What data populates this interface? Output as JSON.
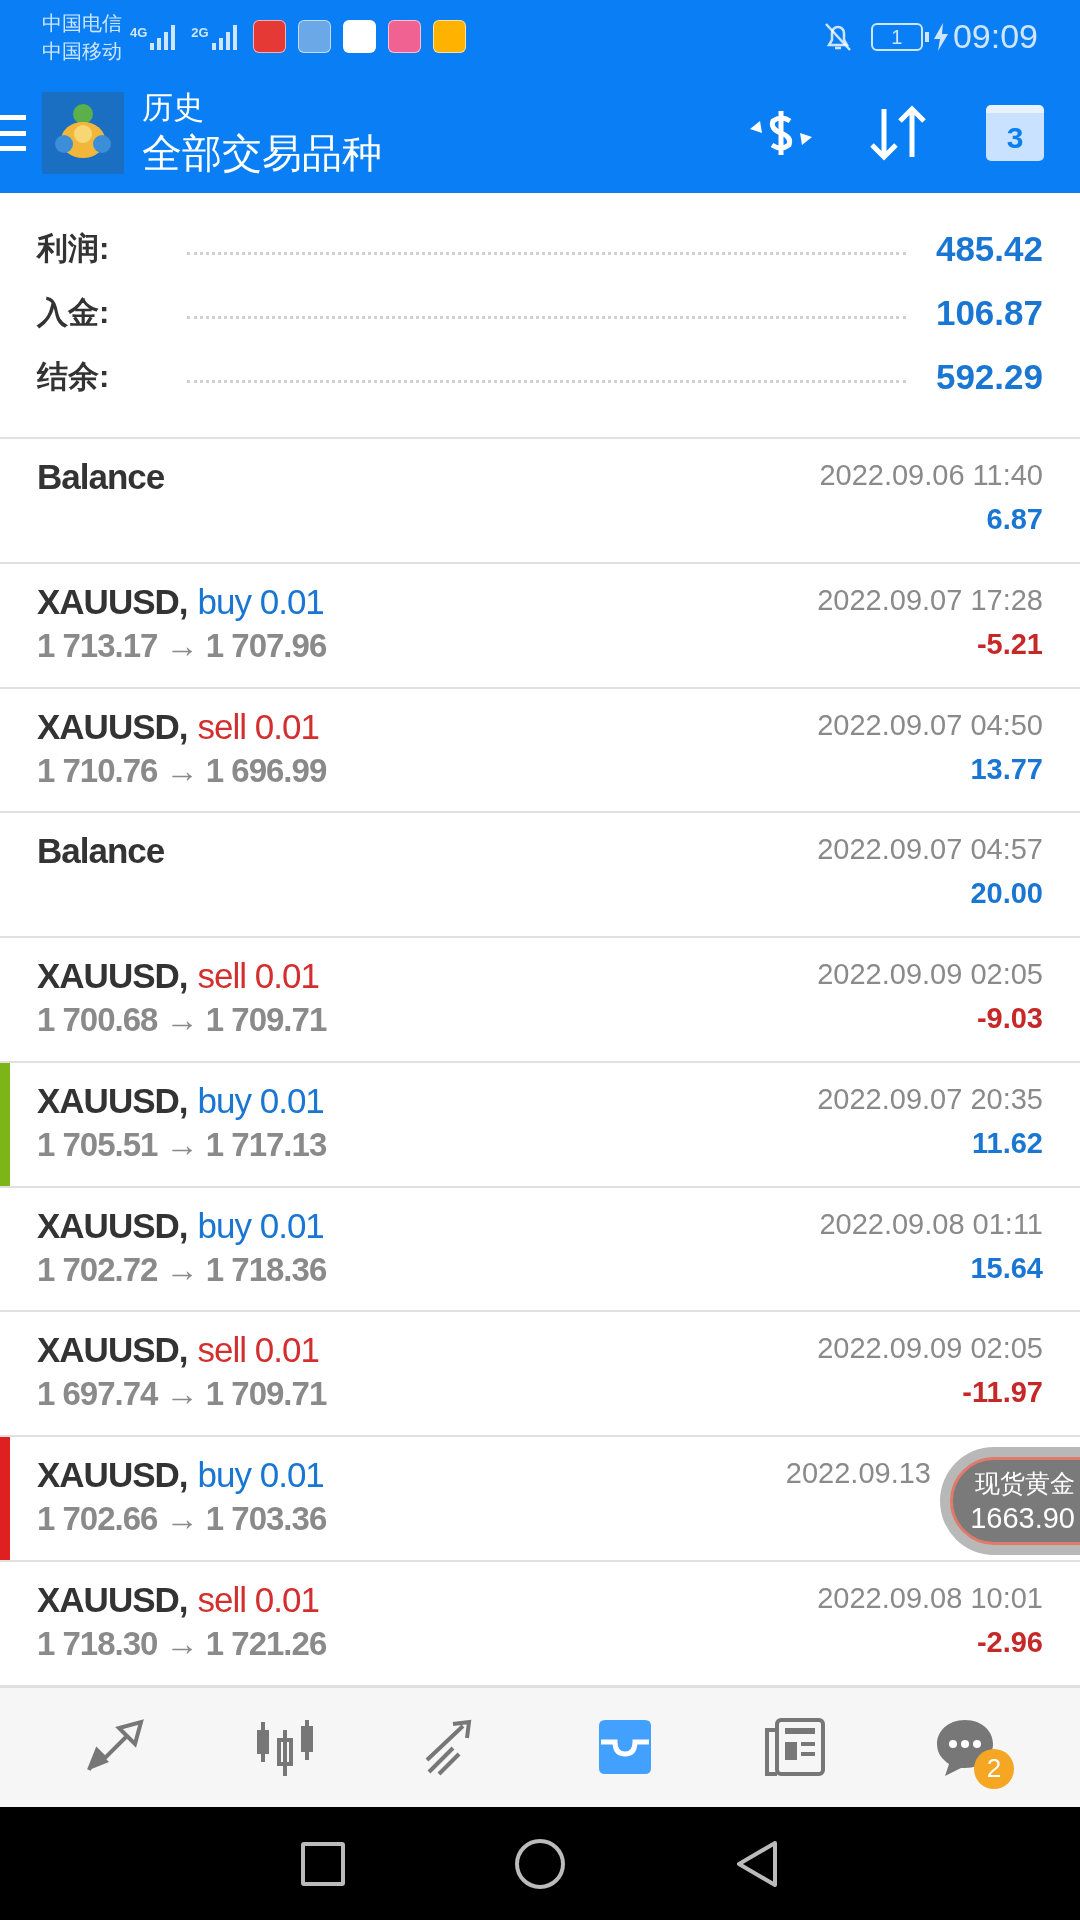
{
  "status_bar": {
    "carrier_1": "中国电信",
    "carrier_2": "中国移动",
    "network_1": "4G",
    "network_2": "2G",
    "sim_badge": "1",
    "time": "09:09"
  },
  "header": {
    "title": "历史",
    "subtitle": "全部交易品种",
    "calendar_day": "3"
  },
  "summary": [
    {
      "label": "利润:",
      "value": "485.42"
    },
    {
      "label": "入金:",
      "value": "106.87"
    },
    {
      "label": "结余:",
      "value": "592.29"
    }
  ],
  "rows": [
    {
      "kind": "balance",
      "symbol": "Balance",
      "time": "2022.09.06 11:40",
      "profit": "6.87",
      "loss": false
    },
    {
      "kind": "buy",
      "symbol": "XAUUSD,",
      "order": "buy 0.01",
      "prices": "1 713.17 → 1 707.96",
      "time": "2022.09.07 17:28",
      "profit": "-5.21",
      "loss": true
    },
    {
      "kind": "sell",
      "symbol": "XAUUSD,",
      "order": "sell 0.01",
      "prices": "1 710.76 → 1 696.99",
      "time": "2022.09.07 04:50",
      "profit": "13.77",
      "loss": false
    },
    {
      "kind": "balance",
      "symbol": "Balance",
      "time": "2022.09.07 04:57",
      "profit": "20.00",
      "loss": false
    },
    {
      "kind": "sell",
      "symbol": "XAUUSD,",
      "order": "sell 0.01",
      "prices": "1 700.68 → 1 709.71",
      "time": "2022.09.09 02:05",
      "profit": "-9.03",
      "loss": true
    },
    {
      "kind": "buy",
      "symbol": "XAUUSD,",
      "order": "buy 0.01",
      "prices": "1 705.51 → 1 717.13",
      "time": "2022.09.07 20:35",
      "profit": "11.62",
      "loss": false,
      "color": "#7cb518"
    },
    {
      "kind": "buy",
      "symbol": "XAUUSD,",
      "order": "buy 0.01",
      "prices": "1 702.72 → 1 718.36",
      "time": "2022.09.08 01:11",
      "profit": "15.64",
      "loss": false
    },
    {
      "kind": "sell",
      "symbol": "XAUUSD,",
      "order": "sell 0.01",
      "prices": "1 697.74 → 1 709.71",
      "time": "2022.09.09 02:05",
      "profit": "-11.97",
      "loss": true
    },
    {
      "kind": "buy",
      "symbol": "XAUUSD,",
      "order": "buy 0.01",
      "prices": "1 702.66 → 1 703.36",
      "time": "2022.09.13",
      "color": "#e02020"
    },
    {
      "kind": "sell",
      "symbol": "XAUUSD,",
      "order": "sell 0.01",
      "prices": "1 718.30 → 1 721.26",
      "time": "2022.09.08 10:01",
      "profit": "-2.96",
      "loss": true
    }
  ],
  "price_widget": {
    "name": "现货黄金",
    "price": "1663.90"
  },
  "bottom_nav": [
    {
      "kind": "quotes",
      "selected": false
    },
    {
      "kind": "chart",
      "selected": false
    },
    {
      "kind": "trade",
      "selected": false
    },
    {
      "kind": "history",
      "selected": true
    },
    {
      "kind": "news",
      "selected": false
    },
    {
      "kind": "messages",
      "selected": false,
      "badge": "2"
    }
  ]
}
